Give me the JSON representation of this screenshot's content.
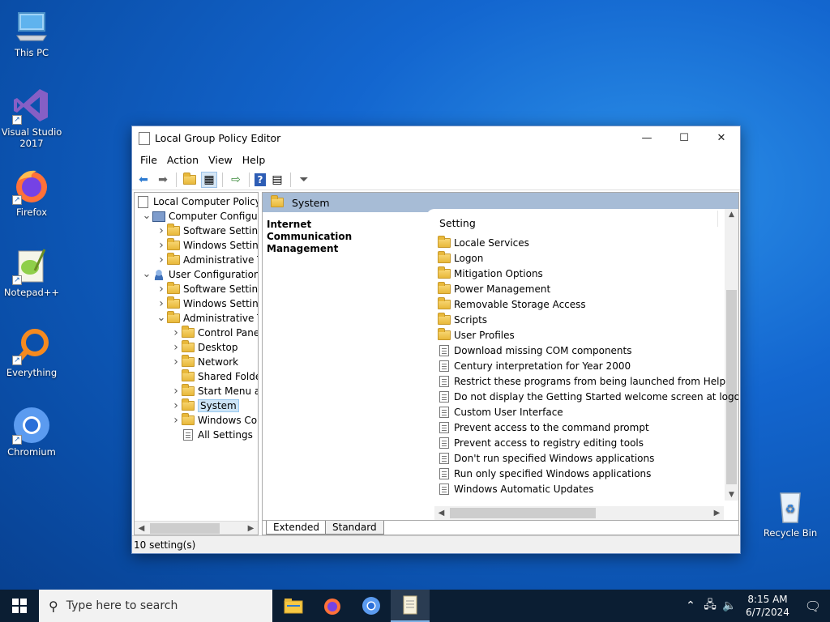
{
  "desktop": {
    "icons": [
      {
        "label": "This PC",
        "icon": "this-pc-icon"
      },
      {
        "label": "Visual Studio 2017",
        "icon": "visual-studio-icon"
      },
      {
        "label": "Firefox",
        "icon": "firefox-icon"
      },
      {
        "label": "Notepad++",
        "icon": "notepad-plus-plus-icon"
      },
      {
        "label": "Everything",
        "icon": "everything-search-icon"
      },
      {
        "label": "Chromium",
        "icon": "chromium-icon"
      },
      {
        "label": "Recycle Bin",
        "icon": "recycle-bin-icon"
      }
    ]
  },
  "window": {
    "title": "Local Group Policy Editor",
    "menu": [
      "File",
      "Action",
      "View",
      "Help"
    ],
    "toolbar_icons": [
      "back-arrow-icon",
      "forward-arrow-icon",
      "up-folder-icon",
      "show-hide-tree-icon",
      "export-list-icon",
      "help-icon",
      "properties-icon",
      "filter-icon"
    ],
    "tree": [
      {
        "label": "Local Computer Policy",
        "level": 0,
        "icon": "policy",
        "expander": ""
      },
      {
        "label": "Computer Configura",
        "level": 1,
        "icon": "computer",
        "expander": "expanded"
      },
      {
        "label": "Software Settings",
        "level": 2,
        "icon": "folder",
        "expander": "collapsed"
      },
      {
        "label": "Windows Setting",
        "level": 2,
        "icon": "folder",
        "expander": "collapsed"
      },
      {
        "label": "Administrative Te",
        "level": 2,
        "icon": "folder",
        "expander": "collapsed"
      },
      {
        "label": "User Configuration",
        "level": 1,
        "icon": "user",
        "expander": "expanded"
      },
      {
        "label": "Software Settings",
        "level": 2,
        "icon": "folder",
        "expander": "collapsed"
      },
      {
        "label": "Windows Setting",
        "level": 2,
        "icon": "folder",
        "expander": "collapsed"
      },
      {
        "label": "Administrative Te",
        "level": 2,
        "icon": "folder",
        "expander": "expanded"
      },
      {
        "label": "Control Panel",
        "level": 3,
        "icon": "folder",
        "expander": "collapsed"
      },
      {
        "label": "Desktop",
        "level": 3,
        "icon": "folder",
        "expander": "collapsed"
      },
      {
        "label": "Network",
        "level": 3,
        "icon": "folder",
        "expander": "collapsed"
      },
      {
        "label": "Shared Folder",
        "level": 3,
        "icon": "folder",
        "expander": ""
      },
      {
        "label": "Start Menu ar",
        "level": 3,
        "icon": "folder",
        "expander": "collapsed"
      },
      {
        "label": "System",
        "level": 3,
        "icon": "folder",
        "expander": "collapsed",
        "selected": true
      },
      {
        "label": "Windows Cor",
        "level": 3,
        "icon": "folder",
        "expander": "collapsed"
      },
      {
        "label": "All Settings",
        "level": 3,
        "icon": "all-settings",
        "expander": ""
      }
    ],
    "header_title": "System",
    "description": "Internet Communication Management",
    "column_header": "Setting",
    "settings": [
      {
        "label": "Locale Services",
        "type": "folder"
      },
      {
        "label": "Logon",
        "type": "folder"
      },
      {
        "label": "Mitigation Options",
        "type": "folder"
      },
      {
        "label": "Power Management",
        "type": "folder"
      },
      {
        "label": "Removable Storage Access",
        "type": "folder"
      },
      {
        "label": "Scripts",
        "type": "folder"
      },
      {
        "label": "User Profiles",
        "type": "folder"
      },
      {
        "label": "Download missing COM components",
        "type": "policy"
      },
      {
        "label": "Century interpretation for Year 2000",
        "type": "policy"
      },
      {
        "label": "Restrict these programs from being launched from Help",
        "type": "policy"
      },
      {
        "label": "Do not display the Getting Started welcome screen at logon",
        "type": "policy"
      },
      {
        "label": "Custom User Interface",
        "type": "policy"
      },
      {
        "label": "Prevent access to the command prompt",
        "type": "policy"
      },
      {
        "label": "Prevent access to registry editing tools",
        "type": "policy"
      },
      {
        "label": "Don't run specified Windows applications",
        "type": "policy"
      },
      {
        "label": "Run only specified Windows applications",
        "type": "policy"
      },
      {
        "label": "Windows Automatic Updates",
        "type": "policy"
      }
    ],
    "tabs": [
      "Extended",
      "Standard"
    ],
    "status": "10 setting(s)"
  },
  "taskbar": {
    "search_placeholder": "Type here to search",
    "apps": [
      "file-explorer-icon",
      "firefox-icon",
      "chromium-icon",
      "group-policy-editor-icon"
    ],
    "time": "8:15 AM",
    "date": "6/7/2024"
  }
}
